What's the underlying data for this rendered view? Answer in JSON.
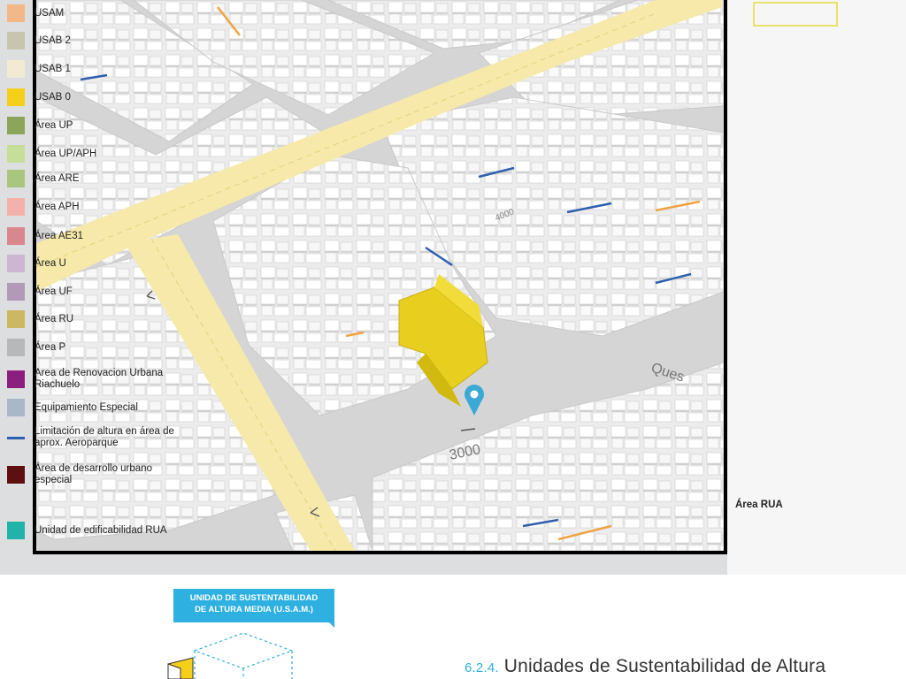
{
  "map": {
    "street_labels": [
      "4000",
      "3000",
      "Ques"
    ]
  },
  "legend": {
    "items": [
      {
        "label": "USAM",
        "color": "#f2b889",
        "type": "fill"
      },
      {
        "label": "USAB 2",
        "color": "#c8c5ae",
        "type": "fill"
      },
      {
        "label": "USAB 1",
        "color": "#f1ebd3",
        "type": "fill"
      },
      {
        "label": "USAB 0",
        "color": "#f6cf1a",
        "type": "fill"
      },
      {
        "label": "Área UP",
        "color": "#8ca55a",
        "type": "fill"
      },
      {
        "label": "Área UP/APH",
        "color": "#c7de98",
        "type": "fill"
      },
      {
        "label": "Área ARE",
        "color": "#aac67e",
        "type": "fill"
      },
      {
        "label": "Área APH",
        "color": "#f4b1ac",
        "type": "fill"
      },
      {
        "label": "Área AE31",
        "color": "#d9878e",
        "type": "fill"
      },
      {
        "label": "Área U",
        "color": "#cdb6d3",
        "type": "fill"
      },
      {
        "label": "Área UF",
        "color": "#b09ab8",
        "type": "fill"
      },
      {
        "label": "Área RU",
        "color": "#cbb861",
        "type": "fill"
      },
      {
        "label": "Área P",
        "color": "#b7b8b8",
        "type": "fill"
      },
      {
        "label": "Area de Renovacion Urbana Riachuelo",
        "color": "#8a1f7d",
        "type": "fill"
      },
      {
        "label": "Equipamiento Especial",
        "color": "#a9b7cb",
        "type": "fill"
      },
      {
        "label": "Limitación de altura en área de aprox. Aeroparque",
        "color": "#2f5fae",
        "type": "line"
      },
      {
        "label": "Área de desarrollo urbano especial",
        "color": "#5e1010",
        "type": "fill"
      }
    ],
    "section_title": "Área RUA",
    "rua_item": {
      "label": "Unidad de edificabilidad RUA",
      "color": "#21b3a8"
    }
  },
  "usam_tag": {
    "line1": "UNIDAD DE SUSTENTABILIDAD",
    "line2": "DE ALTURA MEDIA (U.S.A.M.)"
  },
  "section": {
    "number": "6.2.4.",
    "title": "Unidades de Sustentabilidad de Altura"
  }
}
